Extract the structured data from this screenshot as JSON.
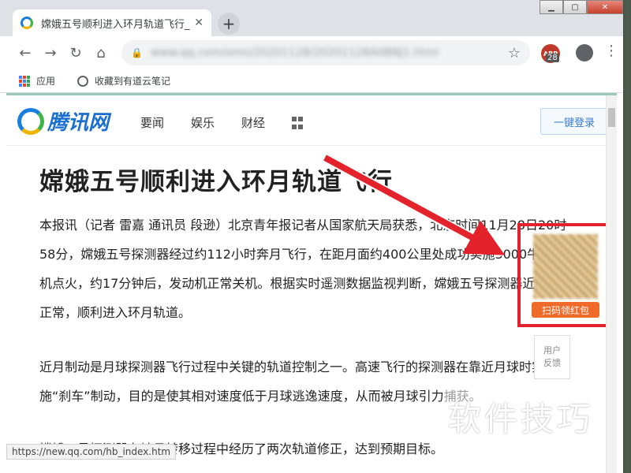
{
  "browser": {
    "tab_title": "嫦娥五号顺利进入环月轨道飞行_",
    "tab_close": "✕",
    "new_tab": "+",
    "url": "www.qq.com/omn/20201128/20201128A0BNJ1.html",
    "extension_badge": "28",
    "extension_label": "ABP",
    "bookmarks": [
      "应用",
      "收藏到有道云笔记"
    ]
  },
  "site": {
    "logo_text": "腾讯网",
    "nav": [
      "要闻",
      "娱乐",
      "财经"
    ],
    "login_button": "一键登录"
  },
  "article": {
    "headline": "嫦娥五号顺利进入环月轨道飞行",
    "paragraphs": [
      "本报讯（记者 雷嘉 通讯员 段逊）北京青年报记者从国家航天局获悉，北京时间11月28日20时58分，嫦娥五号探测器经过约112小时奔月飞行，在距月面约400公里处成功实施3000牛发动机点火，约17分钟后，发动机正常关机。根据实时遥测数据监视判断，嫦娥五号探测器近月制动正常，顺利进入环月轨道。",
      "近月制动是月球探测器飞行过程中关键的轨道控制之一。高速飞行的探测器在靠近月球时实施“刹车”制动，目的是使其相对速度低于月球逃逸速度，从而被月球引力捕获。",
      "嫦娥五号探测器在地月转移过程中经历了两次轨道修正，达到预期目标。"
    ]
  },
  "sidebar": {
    "red_packet_label": "扫码领红包",
    "feedback_label": "用户\n反馈"
  },
  "status_url": "https://new.qq.com/hb_index.htm",
  "watermark": "软件技巧"
}
